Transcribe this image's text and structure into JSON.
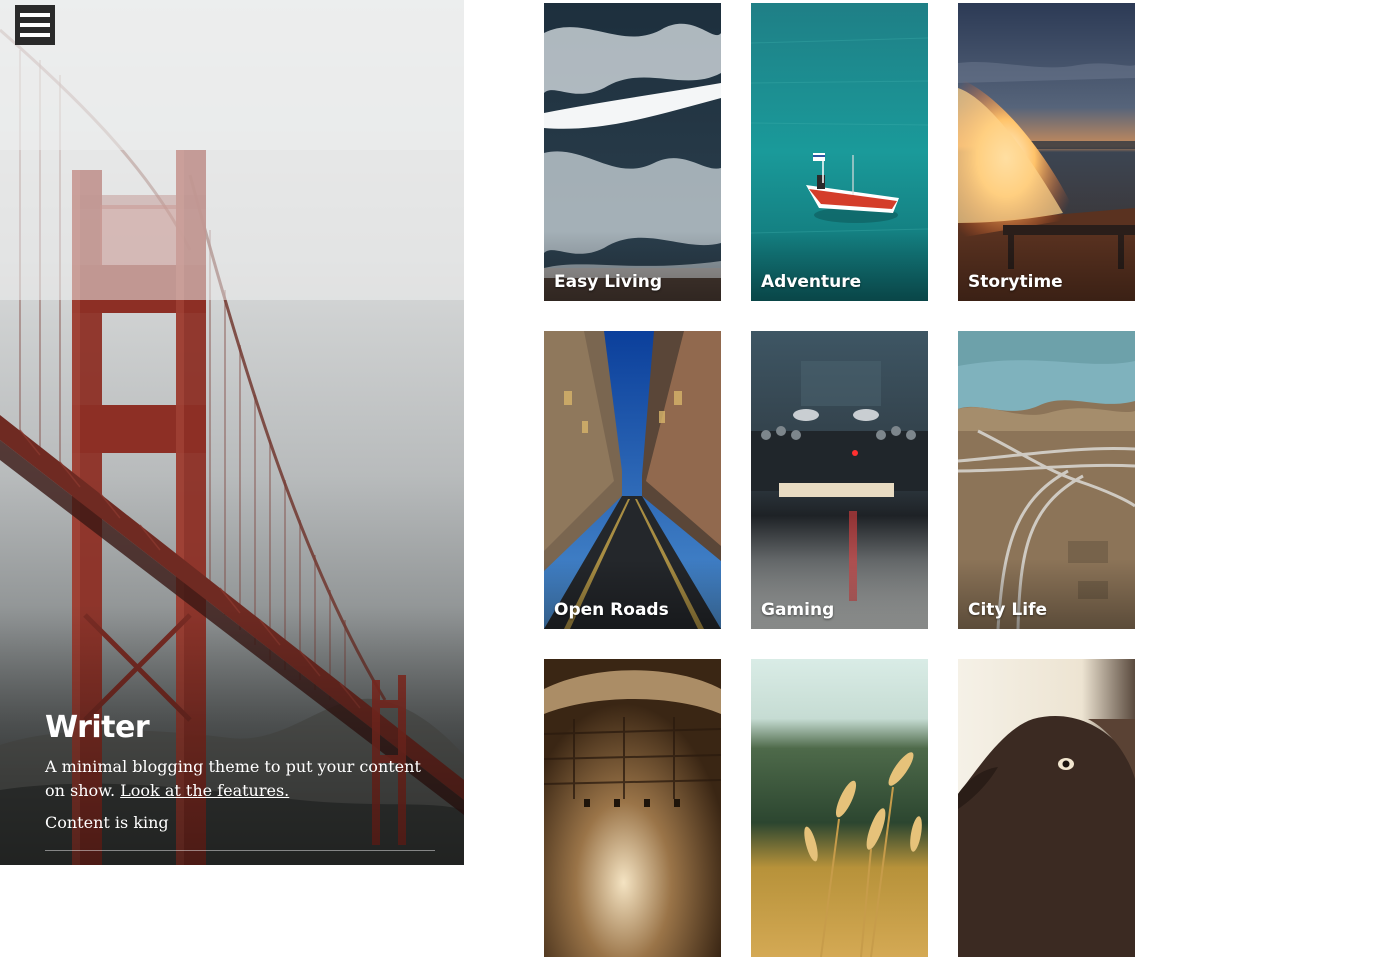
{
  "header": {
    "menu_icon": "hamburger-menu-icon"
  },
  "site": {
    "title": "Writer",
    "description": "A minimal blogging theme to put your content on show.",
    "features_link": "Look at the features.",
    "tagline": "Content is king"
  },
  "tiles": [
    {
      "label": "Easy Living"
    },
    {
      "label": "Adventure"
    },
    {
      "label": "Storytime"
    },
    {
      "label": "Open Roads"
    },
    {
      "label": "Gaming"
    },
    {
      "label": "City Life"
    },
    {
      "label": ""
    },
    {
      "label": ""
    },
    {
      "label": ""
    }
  ],
  "colors": {
    "sidebar_text": "#ffffff",
    "menu_button_bg": "#2a2a2a",
    "bridge_red": "#8d2f25",
    "page_bg": "#ffffff"
  }
}
